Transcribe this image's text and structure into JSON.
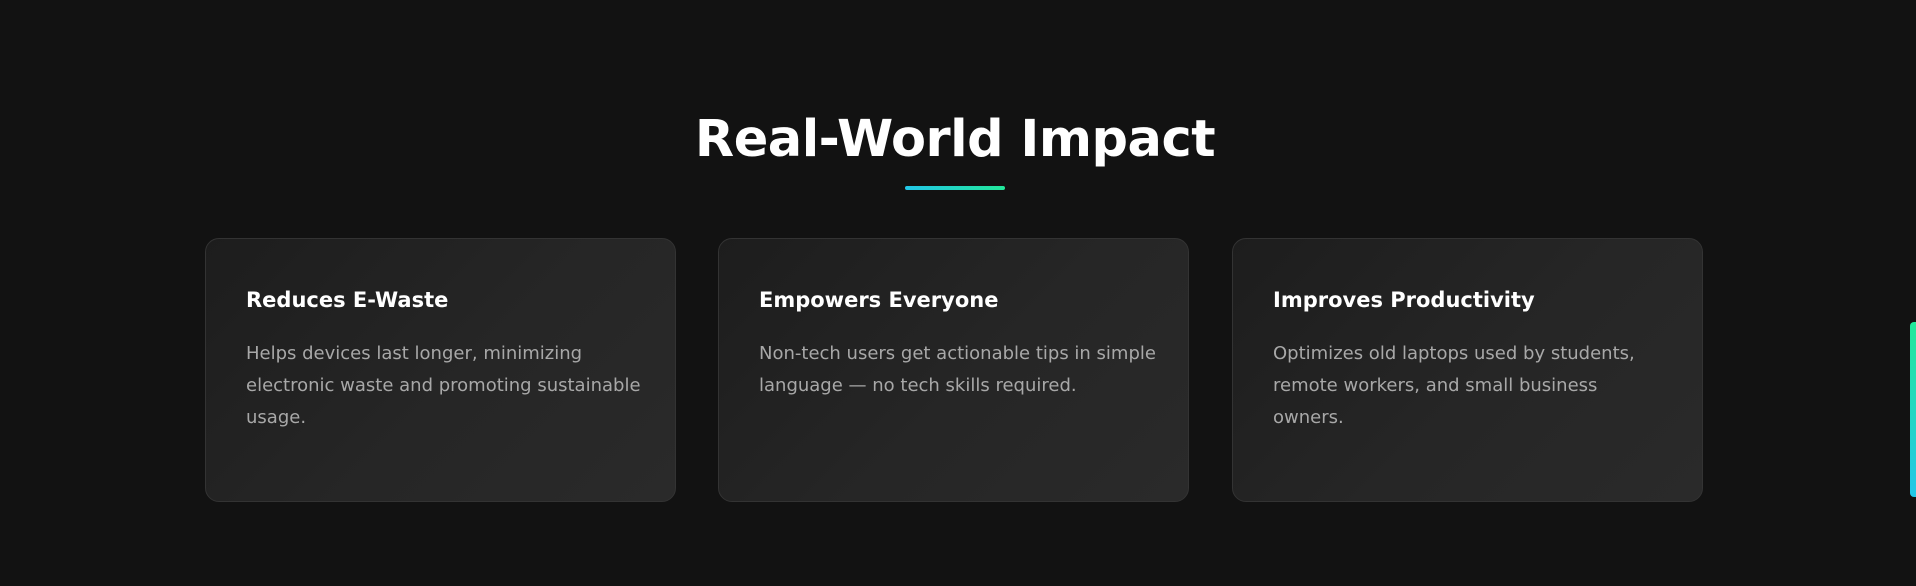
{
  "section": {
    "title": "Real-World Impact",
    "underline_gradient": [
      "#22c6e8",
      "#22e89a"
    ]
  },
  "cards": [
    {
      "title": "Reduces E-Waste",
      "text": "Helps devices last longer, minimizing electronic waste and promoting sustainable usage."
    },
    {
      "title": "Empowers Everyone",
      "text": "Non-tech users get actionable tips in simple language — no tech skills required."
    },
    {
      "title": "Improves Productivity",
      "text": "Optimizes old laptops used by students, remote workers, and small business owners."
    }
  ],
  "colors": {
    "background": "#121212",
    "card_border": "#333333",
    "title_text": "#ffffff",
    "body_text": "#a8a8a8",
    "accent_teal": "#22c6e8",
    "accent_green": "#22e89a"
  }
}
